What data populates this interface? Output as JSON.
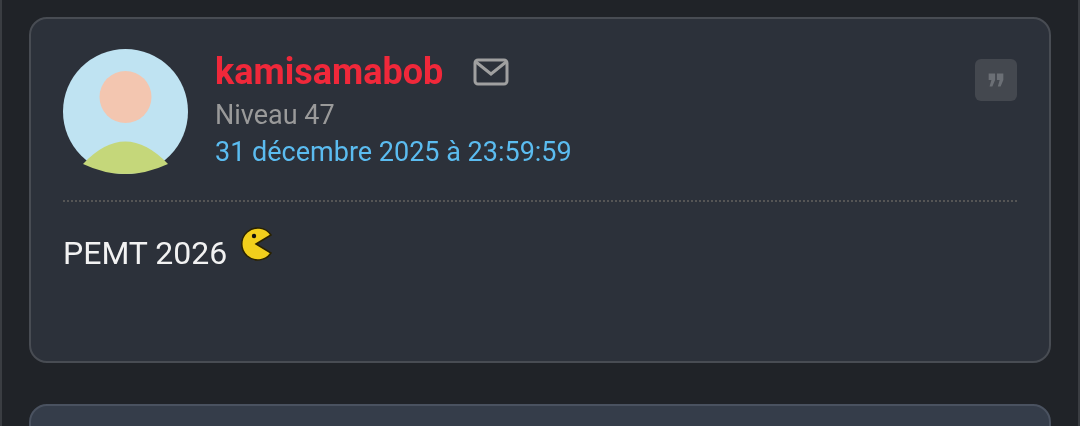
{
  "post": {
    "author": "kamisamabob",
    "level": "Niveau 47",
    "date": "31 décembre 2025 à 23:59:59",
    "body": "PEMT 2026"
  }
}
